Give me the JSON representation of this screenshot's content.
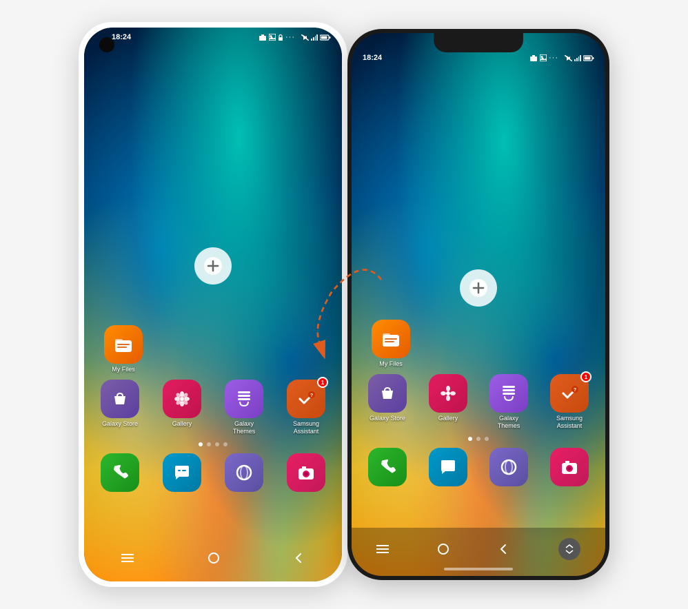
{
  "page": {
    "background": "#f5f5f5"
  },
  "phone1": {
    "type": "samsung_galaxy",
    "status_bar": {
      "time": "18:24",
      "icons": [
        "camera",
        "image",
        "lock",
        "more"
      ]
    },
    "upload_icon": "+",
    "apps_row1": [
      {
        "id": "my-files",
        "label": "My Files",
        "icon": "folder",
        "badge": false
      }
    ],
    "apps_row2": [
      {
        "id": "galaxy-store",
        "label": "Galaxy Store",
        "icon": "bag",
        "badge": false
      },
      {
        "id": "gallery",
        "label": "Gallery",
        "icon": "flower",
        "badge": false
      },
      {
        "id": "galaxy-themes",
        "label": "Galaxy\nThemes",
        "icon": "brush",
        "badge": false
      },
      {
        "id": "samsung-assistant",
        "label": "Samsung\nAssistant",
        "icon": "check",
        "badge": true,
        "badge_count": "1"
      }
    ],
    "page_dots": [
      {
        "active": true
      },
      {
        "active": false
      },
      {
        "active": false
      },
      {
        "active": false
      }
    ],
    "dock_apps": [
      {
        "id": "phone",
        "label": "",
        "icon": "phone"
      },
      {
        "id": "messenger",
        "label": "",
        "icon": "chat"
      },
      {
        "id": "opera",
        "label": "",
        "icon": "opera"
      },
      {
        "id": "snap",
        "label": "",
        "icon": "camera2"
      }
    ],
    "nav": [
      "menu",
      "home",
      "back"
    ]
  },
  "phone2": {
    "type": "iphone_style",
    "status_bar": {
      "time": "18:24",
      "icons": [
        "camera",
        "image",
        "more"
      ]
    },
    "upload_icon": "+",
    "apps_row1": [
      {
        "id": "my-files",
        "label": "My Files",
        "icon": "folder",
        "badge": false
      }
    ],
    "apps_row2": [
      {
        "id": "galaxy-store",
        "label": "Galaxy Store",
        "icon": "bag",
        "badge": false
      },
      {
        "id": "gallery",
        "label": "Gallery",
        "icon": "flower",
        "badge": false
      },
      {
        "id": "galaxy-themes",
        "label": "Galaxy\nThemes",
        "icon": "brush",
        "badge": false
      },
      {
        "id": "samsung-assistant",
        "label": "Samsung\nAssistant",
        "icon": "check",
        "badge": true,
        "badge_count": "1"
      }
    ],
    "page_dots": [
      {
        "active": true
      },
      {
        "active": false
      },
      {
        "active": false
      }
    ],
    "dock_apps": [
      {
        "id": "phone",
        "label": "",
        "icon": "phone"
      },
      {
        "id": "messenger",
        "label": "",
        "icon": "chat"
      },
      {
        "id": "opera",
        "label": "",
        "icon": "opera"
      },
      {
        "id": "snap",
        "label": "",
        "icon": "camera2"
      }
    ],
    "nav": [
      "menu",
      "home",
      "back"
    ],
    "extra_button": "scroll"
  },
  "arrow": {
    "color": "#e05c1e",
    "style": "dashed"
  }
}
